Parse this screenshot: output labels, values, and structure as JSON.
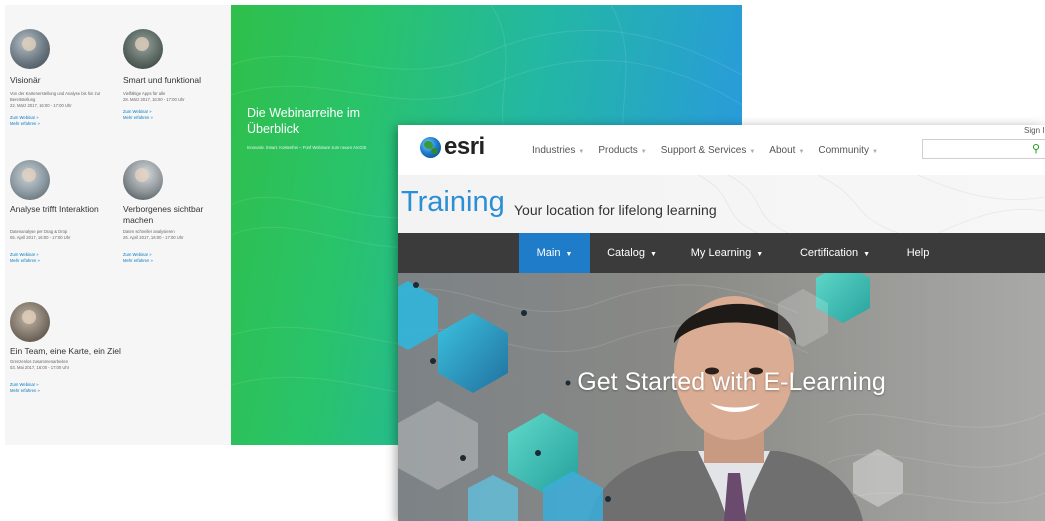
{
  "webinar_series": {
    "items": [
      {
        "title": "Visionär",
        "description": "Von der Kartenerstellung und Analyse bis hin zur Bereitstellung",
        "date": "22. März 2017, 16:00 - 17:00 Uhr",
        "link_webinar": "Zum Webinar »",
        "link_more": "Mehr erfahren »"
      },
      {
        "title": "Smart und funktional",
        "description": "Vielfältige Apps für alle",
        "date": "28. März 2017, 16:00 - 17:00 Uhr",
        "link_webinar": "Zum Webinar »",
        "link_more": "Mehr erfahren »"
      },
      {
        "title": "Analyse trifft Interaktion",
        "description": "Datenanalyse per Drag & Drop",
        "date": "05. April 2017, 16:00 - 17:00 Uhr",
        "link_webinar": "Zum Webinar »",
        "link_more": "Mehr erfahren »"
      },
      {
        "title": "Verborgenes sichtbar machen",
        "description": "Daten schneller analysieren",
        "date": "26. April 2017, 16:00 - 17:00 Uhr",
        "link_webinar": "Zum Webinar »",
        "link_more": "Mehr erfahren »"
      },
      {
        "title": "Ein Team, eine Karte, ein Ziel",
        "description": "Grenzenlos zusammenarbeiten",
        "date": "03. Mai 2017, 16:00 - 17:00 Uhr",
        "link_webinar": "Zum Webinar »",
        "link_more": "Mehr erfahren »"
      }
    ],
    "promo_title": "Die Webinarreihe im Überblick",
    "promo_subtitle": "Innovativ. Smart. Kostenfrei – Fünf Webinare zum neuen ArcGIS",
    "promo_gradient": [
      "#2fbf4a",
      "#2a94e8"
    ]
  },
  "esri_training": {
    "logo_text": "esri",
    "logo_icon": "globe-icon",
    "top_nav": [
      {
        "label": "Industries"
      },
      {
        "label": "Products"
      },
      {
        "label": "Support & Services"
      },
      {
        "label": "About"
      },
      {
        "label": "Community"
      }
    ],
    "sign_in": "Sign I",
    "search_placeholder": "",
    "section_title": "Training",
    "tagline": "Your location for lifelong learning",
    "main_nav": [
      {
        "label": "Main",
        "has_caret": true,
        "active": true
      },
      {
        "label": "Catalog",
        "has_caret": true,
        "active": false
      },
      {
        "label": "My Learning",
        "has_caret": true,
        "active": false
      },
      {
        "label": "Certification",
        "has_caret": true,
        "active": false
      },
      {
        "label": "Help",
        "has_caret": false,
        "active": false
      }
    ],
    "hero_heading": "Get Started with E-Learning",
    "colors": {
      "accent_blue": "#1f7cc9",
      "title_blue": "#2b8fd6",
      "nav_dark": "#3b3b3b",
      "search_green": "#1a9a1a"
    }
  }
}
